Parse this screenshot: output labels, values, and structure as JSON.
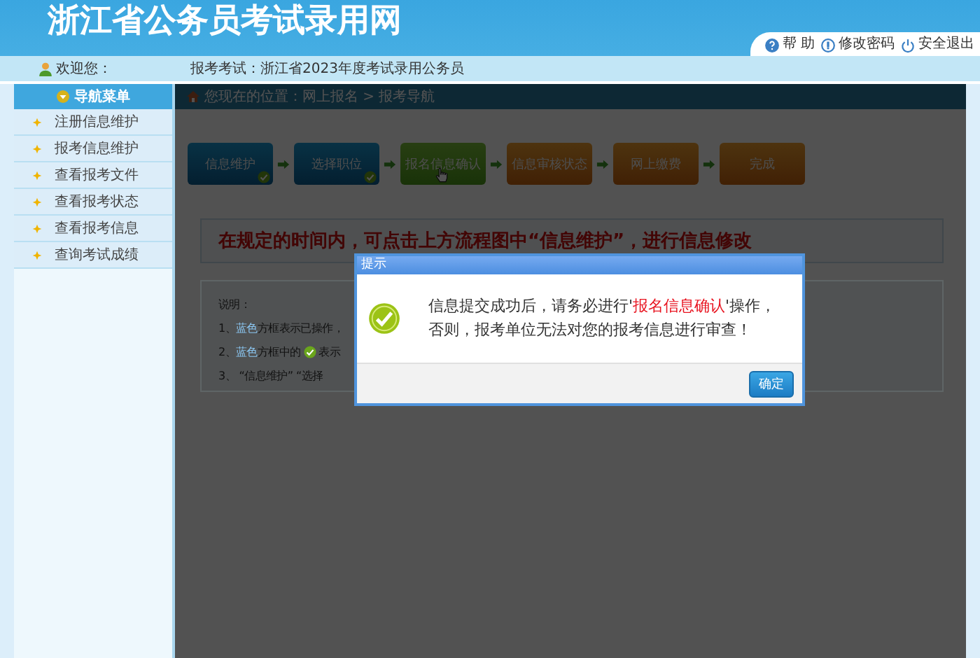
{
  "header": {
    "title": "浙江省公务员考试录用网",
    "links": [
      {
        "kind": "help",
        "label": "帮 助"
      },
      {
        "kind": "password",
        "label": "修改密码"
      },
      {
        "kind": "logout",
        "label": "安全退出"
      }
    ]
  },
  "info_bar": {
    "welcome": "欢迎您：",
    "exam": "报考考试：浙江省2023年度考试录用公务员"
  },
  "sidebar": {
    "title": "导航菜单",
    "items": [
      "注册信息维护",
      "报考信息维护",
      "查看报考文件",
      "查看报考状态",
      "查看报考信息",
      "查询考试成绩"
    ]
  },
  "breadcrumb": "您现在的位置：网上报名 > 报考导航",
  "steps": [
    {
      "label": "信息维护",
      "kind": "blue",
      "done": true
    },
    {
      "label": "选择职位",
      "kind": "blue",
      "done": true
    },
    {
      "label": "报名信息确认",
      "kind": "green",
      "done": false
    },
    {
      "label": "信息审核状态",
      "kind": "orange",
      "done": false
    },
    {
      "label": "网上缴费",
      "kind": "orange",
      "done": false
    },
    {
      "label": "完成",
      "kind": "orange",
      "done": false
    }
  ],
  "notice": "在规定的时间内，可点击上方流程图中“信息维护”，进行信息修改",
  "notes": {
    "title": "说明：",
    "items": [
      [
        {
          "text": "1、"
        },
        {
          "text": "蓝色",
          "color": "#8ac4ee"
        },
        {
          "text": "方框表示已操作，"
        }
      ],
      [
        {
          "text": "2、"
        },
        {
          "text": "蓝色",
          "color": "#8ac4ee"
        },
        {
          "text": "方框中的"
        },
        {
          "kind": "check"
        },
        {
          "text": "表示"
        }
      ],
      [
        {
          "text": "3、 “信息维护” “选择"
        }
      ]
    ]
  },
  "dialog": {
    "title": "提示",
    "message": [
      {
        "text": "信息提交成功后，请务必进行'"
      },
      {
        "text": "报名信息确认",
        "color": "#e8131f"
      },
      {
        "text": "'操作，否则，报考单位无法对您的报考信息进行审查！"
      }
    ],
    "button": "确定"
  }
}
